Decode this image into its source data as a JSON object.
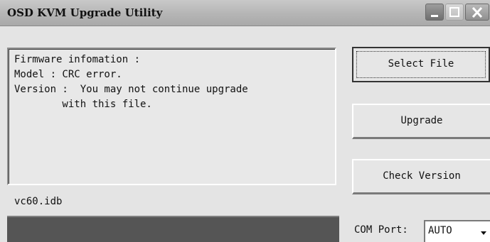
{
  "window": {
    "title": "OSD KVM Upgrade Utility"
  },
  "info": {
    "lines": [
      "Firmware infomation :",
      "Model : CRC error.",
      "Version :  You may not continue upgrade",
      "        with this file."
    ]
  },
  "file": {
    "name": "vc60.idb"
  },
  "buttons": {
    "select_file": "Select File",
    "upgrade": "Upgrade",
    "check_version": "Check Version"
  },
  "com_port": {
    "label": "COM Port:",
    "selected": "AUTO"
  }
}
